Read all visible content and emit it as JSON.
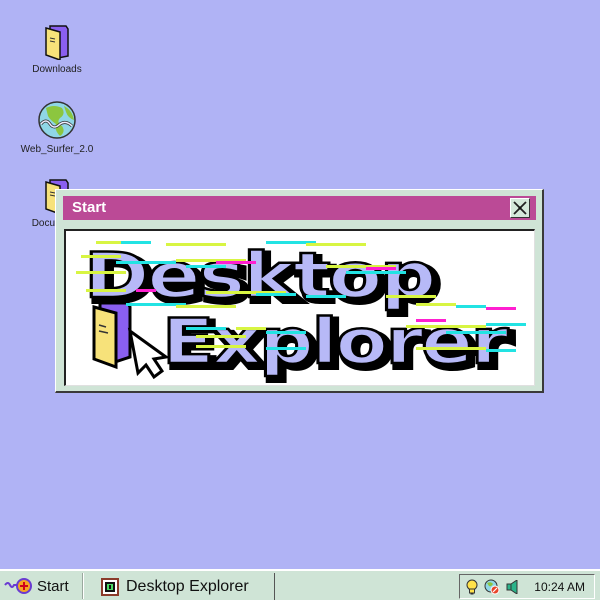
{
  "desktop": {
    "icons": [
      {
        "label": "Downloads",
        "icon": "folder-icon"
      },
      {
        "label": "Web_Surfer_2.0",
        "icon": "globe-icon"
      },
      {
        "label": "Documents",
        "icon": "folder-icon"
      }
    ]
  },
  "window": {
    "title": "Start",
    "close_icon": "close-icon",
    "logo": {
      "line1": "Desktop",
      "line2": "Explorer",
      "icons": [
        "folder-icon",
        "cursor-arrow-icon"
      ]
    }
  },
  "taskbar": {
    "start_label": "Start",
    "start_icon": "start-logo-icon",
    "tasks": [
      {
        "label": "Desktop Explorer",
        "icon": "desktop-explorer-icon"
      }
    ],
    "tray": {
      "icons": [
        "lightbulb-icon",
        "network-globe-icon",
        "speaker-icon"
      ],
      "clock": "10:24 AM"
    }
  },
  "colors": {
    "desktop_bg": "#b0b3f5",
    "titlebar": "#bb4a96",
    "window_chrome": "#cfe4d6",
    "logo_fill": "#b7b9f7",
    "glitch_yellow": "#d8f542",
    "glitch_cyan": "#22e3e3",
    "glitch_magenta": "#ff1fd0"
  }
}
